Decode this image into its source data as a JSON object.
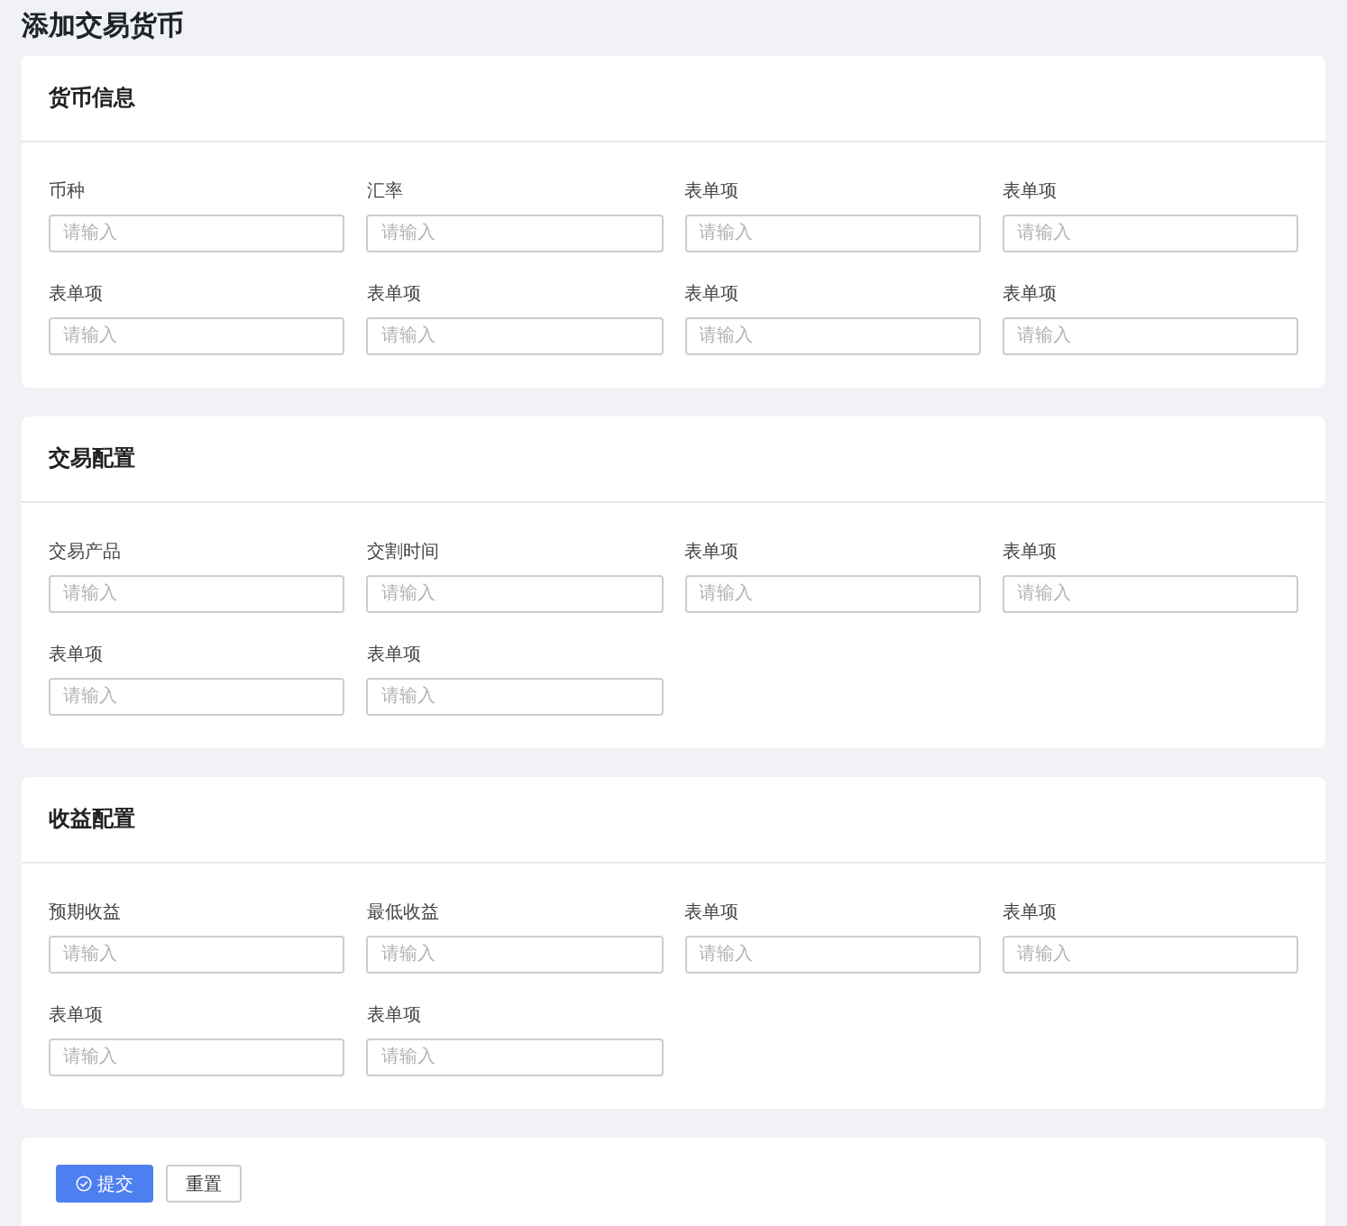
{
  "page_title": "添加交易货币",
  "sections": [
    {
      "title": "货币信息",
      "fields": [
        {
          "label": "币种",
          "placeholder": "请输入"
        },
        {
          "label": "汇率",
          "placeholder": "请输入"
        },
        {
          "label": "表单项",
          "placeholder": "请输入"
        },
        {
          "label": "表单项",
          "placeholder": "请输入"
        },
        {
          "label": "表单项",
          "placeholder": "请输入"
        },
        {
          "label": "表单项",
          "placeholder": "请输入"
        },
        {
          "label": "表单项",
          "placeholder": "请输入"
        },
        {
          "label": "表单项",
          "placeholder": "请输入"
        }
      ]
    },
    {
      "title": "交易配置",
      "fields": [
        {
          "label": "交易产品",
          "placeholder": "请输入"
        },
        {
          "label": "交割时间",
          "placeholder": "请输入"
        },
        {
          "label": "表单项",
          "placeholder": "请输入"
        },
        {
          "label": "表单项",
          "placeholder": "请输入"
        },
        {
          "label": "表单项",
          "placeholder": "请输入"
        },
        {
          "label": "表单项",
          "placeholder": "请输入"
        }
      ]
    },
    {
      "title": "收益配置",
      "fields": [
        {
          "label": "预期收益",
          "placeholder": "请输入"
        },
        {
          "label": "最低收益",
          "placeholder": "请输入"
        },
        {
          "label": "表单项",
          "placeholder": "请输入"
        },
        {
          "label": "表单项",
          "placeholder": "请输入"
        },
        {
          "label": "表单项",
          "placeholder": "请输入"
        },
        {
          "label": "表单项",
          "placeholder": "请输入"
        }
      ]
    }
  ],
  "buttons": [
    {
      "label": "提交",
      "kind": "primary"
    },
    {
      "label": "重置",
      "kind": "default"
    }
  ]
}
